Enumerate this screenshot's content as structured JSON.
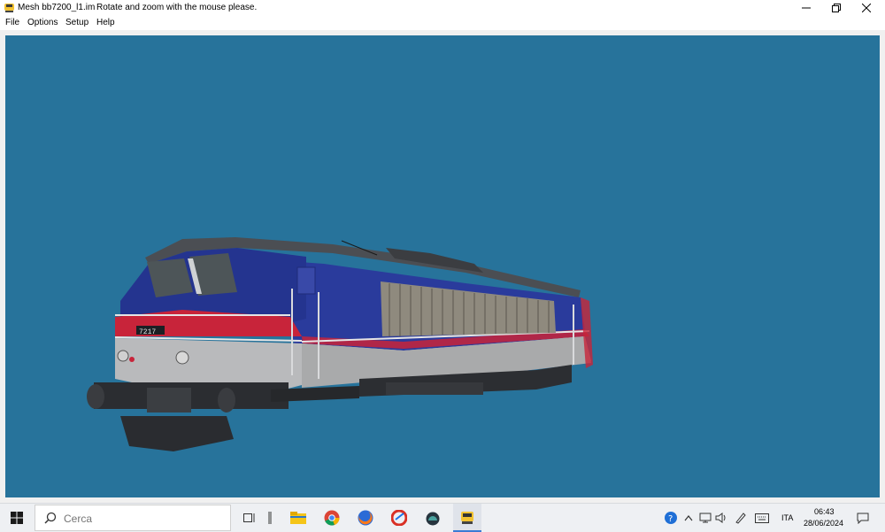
{
  "window": {
    "title": "Mesh bb7200_l1.im",
    "subtitle": "Rotate and zoom with the mouse please.",
    "icon": "locomotive-icon"
  },
  "menu": {
    "file": "File",
    "options": "Options",
    "setup": "Setup",
    "help": "Help"
  },
  "viewport": {
    "background": "#27739b",
    "locomotive_number": "7217",
    "livery": {
      "body_blue": "#2a3b9c",
      "stripe_red": "#c8243a",
      "lower_grey": "#b9babc"
    }
  },
  "taskbar": {
    "search_placeholder": "Cerca",
    "pinned": [
      "task-view-icon",
      "explorer-icon",
      "chrome-icon",
      "firefox-icon",
      "ccleaner-icon",
      "app-icon",
      "locomotive-icon"
    ],
    "tray": {
      "language": "ITA",
      "time": "06:43",
      "date": "28/06/2024"
    }
  }
}
